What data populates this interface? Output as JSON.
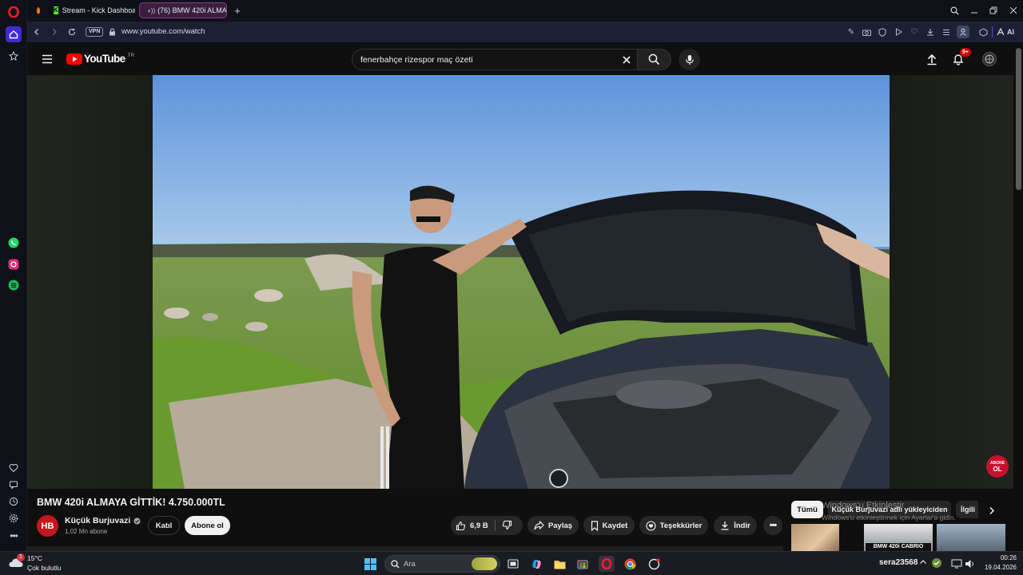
{
  "browser": {
    "tabs": [
      {
        "label": "Stream - Kick Dashboard",
        "active": false
      },
      {
        "label": "(76) BMW 420i ALMA",
        "active": true
      }
    ],
    "url": "www.youtube.com/watch",
    "vpn_label": "VPN",
    "ai_label": "AI",
    "window_buttons": [
      "search",
      "minimize",
      "restore",
      "close"
    ]
  },
  "youtube": {
    "logo_text": "YouTube",
    "region": "TR",
    "search_query": "fenerbahçe rizespor maç özeti",
    "notifications_badge": "9+"
  },
  "video": {
    "title": "BMW 420i ALMAYA GİTTİK! 4.750.000TL",
    "overlay_subscribe": [
      "ABONE",
      "OL"
    ]
  },
  "channel": {
    "avatar_initials": "HB",
    "name": "Küçük Burjuvazi",
    "subscribers": "1,02 Mn abone",
    "join_label": "Katıl",
    "subscribe_label": "Abone ol"
  },
  "actions": {
    "likes": "6,9 B",
    "share": "Paylaş",
    "save": "Kaydet",
    "thanks": "Teşekkürler",
    "download": "İndir"
  },
  "recommendation_chips": [
    "Tümü",
    "Küçük Burjuvazi adlı yükleyiciden",
    "İlgili"
  ],
  "recommendation_thumb_text": "BMW 420i CABRIO",
  "windows_watermark": {
    "line1": "Windows'u Etkinleştir",
    "line2": "Windows'u etkinleştirmek için Ayarlar'a gidin."
  },
  "taskbar": {
    "weather_temp": "15°C",
    "weather_desc": "Çok bulutlu",
    "weather_badge": "1",
    "search_placeholder": "Ara",
    "username": "sera23568",
    "time": "00:26",
    "date": "19.04.2026"
  },
  "colors": {
    "youtube_red": "#ff0000",
    "opera_red": "#ff1b2d",
    "accent_blue": "#3d6bff"
  }
}
